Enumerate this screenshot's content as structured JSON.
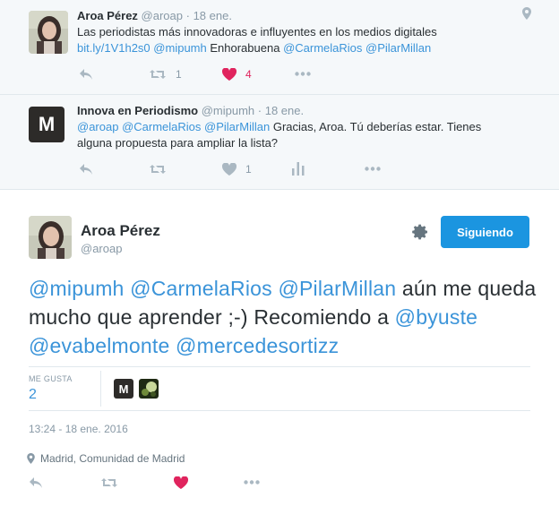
{
  "tweet1": {
    "name": "Aroa Pérez",
    "screen_name": "@aroap",
    "date": "· 18 ene.",
    "text_plain": "Las periodistas más innovadoras e influyentes en los medios digitales",
    "link": "bit.ly/1V1h2s0",
    "mention1": "@mipumh",
    "word": "Enhorabuena",
    "mention2": "@CarmelaRios",
    "mention3": "@PilarMillan",
    "retweets": "1",
    "likes": "4",
    "icons": [
      "reply-icon",
      "retweet-icon",
      "heart-icon",
      "more-icon",
      "location-pin-icon"
    ]
  },
  "tweet2": {
    "name": "Innova en Periodismo",
    "screen_name": "@mipumh",
    "date": "· 18 ene.",
    "mention1": "@aroap",
    "mention2": "@CarmelaRios",
    "mention3": "@PilarMillan",
    "text_rest": "Gracias, Aroa. Tú deberías estar. Tienes alguna propuesta para ampliar la lista?",
    "avatar_letter": "M",
    "likes": "1"
  },
  "main": {
    "name": "Aroa Pérez",
    "screen_name": "@aroap",
    "follow_label": "Siguiendo",
    "m1": "@mipumh",
    "m2": "@CarmelaRios",
    "m3": "@PilarMillan",
    "plain": "aún me queda mucho que aprender ;-) Recomiendo a",
    "m4": "@byuste",
    "m5": "@evabelmonte",
    "m6": "@mercedesortizz",
    "likes_label": "ME GUSTA",
    "likes_count": "2",
    "liker_letter": "M",
    "timestamp": "13:24 - 18 ene. 2016",
    "location": "Madrid, Comunidad de Madrid"
  },
  "colors": {
    "link": "#3b94d9",
    "like_red": "#e0245e",
    "follow_blue": "#1b95e0",
    "muted": "#8899a6",
    "bg_context": "#f5f8fa"
  }
}
